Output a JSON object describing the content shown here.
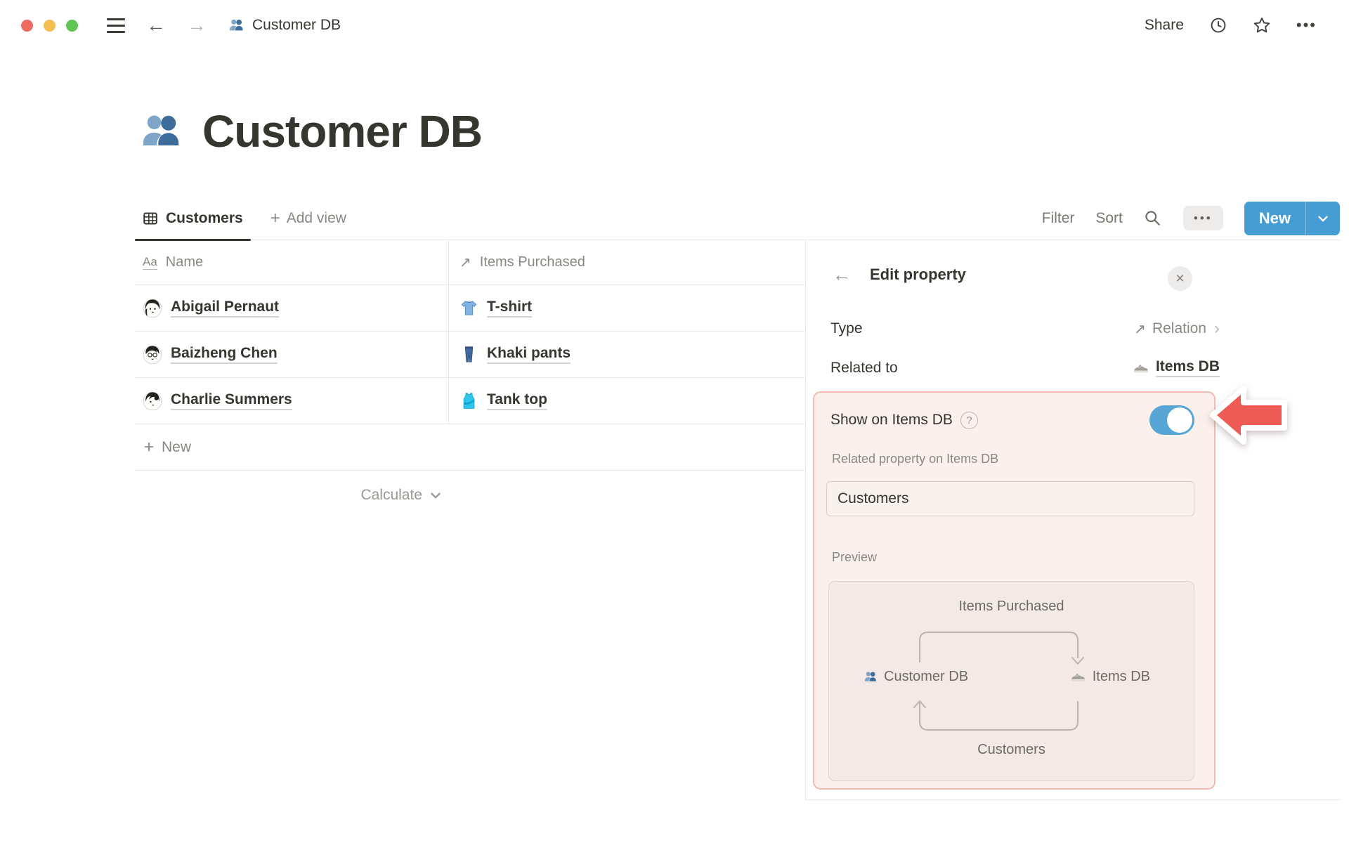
{
  "topbar": {
    "doc_title": "Customer DB",
    "share": "Share"
  },
  "page": {
    "title": "Customer DB"
  },
  "view_bar": {
    "active_tab": "Customers",
    "add_view": "Add view",
    "filter": "Filter",
    "sort": "Sort",
    "new_button": "New"
  },
  "table": {
    "columns": [
      {
        "label": "Name"
      },
      {
        "label": "Items Purchased"
      }
    ],
    "rows": [
      {
        "name": "Abigail Pernaut",
        "item": "T-shirt"
      },
      {
        "name": "Baizheng Chen",
        "item": "Khaki pants"
      },
      {
        "name": "Charlie Summers",
        "item": "Tank top"
      }
    ],
    "new_row": "New",
    "calculate": "Calculate"
  },
  "panel": {
    "title": "Edit property",
    "type_label": "Type",
    "type_value": "Relation",
    "related_to_label": "Related to",
    "related_to_value": "Items DB",
    "show_on_label": "Show on Items DB",
    "related_property_label": "Related property on Items DB",
    "related_property_value": "Customers",
    "preview_label": "Preview",
    "preview": {
      "top": "Items Purchased",
      "left": "Customer DB",
      "right": "Items DB",
      "bottom": "Customers"
    }
  },
  "icons": {
    "plus": "+",
    "back_arrow": "←",
    "forward_arrow": "→",
    "relation_arrow": "↗",
    "chevron_right": "›",
    "ellipsis": "•••",
    "question": "?",
    "close": "×",
    "aa": "Aa"
  },
  "colors": {
    "accent_blue": "#459DD3",
    "toggle_blue": "#57A5D4",
    "highlight_bg": "#FCF0ED",
    "highlight_border": "#F3BBB4",
    "arrow_red": "#EE5B54",
    "text_dark": "#37352F",
    "text_gray": "#8B8883"
  }
}
